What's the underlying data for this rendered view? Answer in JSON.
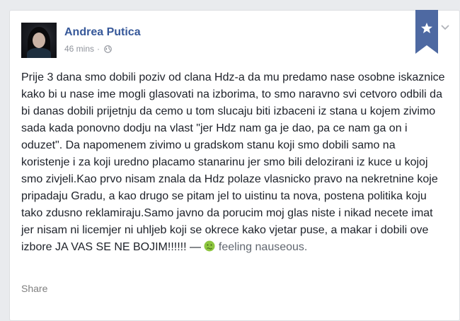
{
  "post": {
    "author": "Andrea Putica",
    "timestamp": "46 mins",
    "separator": "·",
    "privacy_icon": "globe-icon",
    "body_text": "Prije 3 dana smo dobili poziv od clana Hdz-a da mu predamo nase osobne iskaznice kako bi u nase ime mogli glasovati na izborima, to smo naravno svi cetvoro odbili da bi danas dobili prijetnju da cemo u tom slucaju biti izbaceni iz stana u kojem zivimo sada kada ponovno dodju na vlast \"jer Hdz nam ga je dao, pa ce nam ga on i oduzet\". Da napomenem zivimo u gradskom stanu koji smo dobili samo na koristenje i za koji uredno placamo stanarinu jer smo bili delozirani iz kuce u kojoj smo zivjeli.Kao prvo nisam znala da Hdz polaze vlasnicko pravo na nekretnine koje pripadaju Gradu, a kao drugo se pitam jel to uistinu ta nova, postena politika koju tako zdusno reklamiraju.Samo javno da porucim moj glas niste i nikad necete imat jer nisam ni licemjer ni uhljeb koji se okrece kako vjetar puse, a makar i dobili ove izbore JA VAS SE NE BOJIM!!!!!!",
    "feeling_dash": "—",
    "feeling_icon": "nauseous-face-icon",
    "feeling_text": "feeling nauseous."
  },
  "actions": {
    "share_label": "Share"
  },
  "icons": {
    "ribbon": "star-ribbon-icon",
    "options": "chevron-down-icon"
  },
  "colors": {
    "name_link": "#365899",
    "ribbon": "#4e69a2",
    "meta_text": "#90949c",
    "emoji_green": "#8dc63f"
  }
}
